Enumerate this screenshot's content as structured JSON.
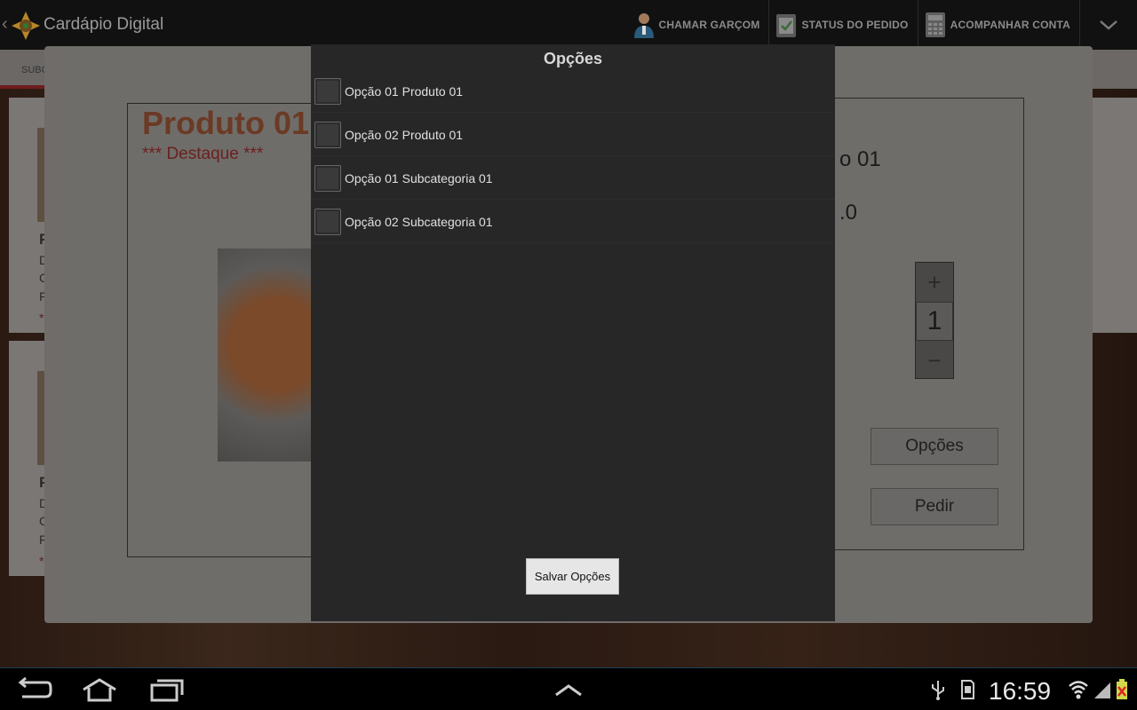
{
  "app": {
    "title": "Cardápio Digital",
    "actions": [
      {
        "label": "CHAMAR GARÇOM",
        "icon": "waiter-icon"
      },
      {
        "label": "STATUS DO PEDIDO",
        "icon": "order-status-icon"
      },
      {
        "label": "ACOMPANHAR CONTA",
        "icon": "calculator-icon"
      }
    ],
    "overflow_icon": "chevron-down-icon"
  },
  "background": {
    "subtab_label": "SUBC",
    "product": {
      "title": "Produto 01",
      "highlight": "*** Destaque ***",
      "right_name_fragment": "o 01",
      "right_price_fragment": ".0",
      "quantity": "1",
      "plus": "+",
      "minus": "−",
      "options_button": "Opções",
      "order_button": "Pedir"
    },
    "list_cards": [
      {
        "t1": "P",
        "t2": "D",
        "t3": "C",
        "t4": "F",
        "t5": "*"
      },
      {
        "t1": "P",
        "t2": "D",
        "t3": "C",
        "t4": "F",
        "t5": "*"
      }
    ],
    "right_card_fragment": "o"
  },
  "dialog": {
    "title": "Opções",
    "options": [
      {
        "label": "Opção 01 Produto 01",
        "checked": false
      },
      {
        "label": "Opção 02 Produto 01",
        "checked": false
      },
      {
        "label": "Opção 01 Subcategoria 01",
        "checked": false
      },
      {
        "label": "Opção 02 Subcategoria 01",
        "checked": false
      }
    ],
    "save_label": "Salvar Opções"
  },
  "system_bar": {
    "clock": "16:59",
    "nav": [
      "back-icon",
      "home-icon",
      "recent-apps-icon",
      "menu-up-icon"
    ],
    "status_icons": [
      "usb-icon",
      "sd-card-icon",
      "wifi-icon",
      "signal-icon",
      "battery-alert-icon"
    ]
  }
}
